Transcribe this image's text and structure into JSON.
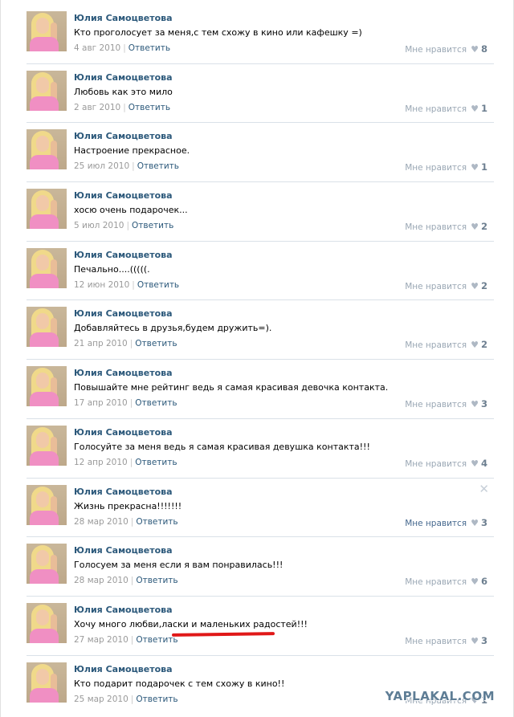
{
  "posts": [
    {
      "author": "Юлия Самоцветова",
      "text": "Кто проголосует за меня,с тем схожу в кино или кафешку =)",
      "date": "4 авг 2010",
      "reply": "Ответить",
      "like_label": "Мне нравится",
      "likes": "8"
    },
    {
      "author": "Юлия Самоцветова",
      "text": "Любовь как это мило",
      "date": "2 авг 2010",
      "reply": "Ответить",
      "like_label": "Мне нравится",
      "likes": "1"
    },
    {
      "author": "Юлия Самоцветова",
      "text": "Настроение прекрасное.",
      "date": "25 июл 2010",
      "reply": "Ответить",
      "like_label": "Мне нравится",
      "likes": "1"
    },
    {
      "author": "Юлия Самоцветова",
      "text": "хосю очень подарочек...",
      "date": "5 июл 2010",
      "reply": "Ответить",
      "like_label": "Мне нравится",
      "likes": "2"
    },
    {
      "author": "Юлия Самоцветова",
      "text": "Печально....(((((.",
      "date": "12 июн 2010",
      "reply": "Ответить",
      "like_label": "Мне нравится",
      "likes": "2"
    },
    {
      "author": "Юлия Самоцветова",
      "text": "Добавляйтесь в друзья,будем дружить=).",
      "date": "21 апр 2010",
      "reply": "Ответить",
      "like_label": "Мне нравится",
      "likes": "2"
    },
    {
      "author": "Юлия Самоцветова",
      "text": "Повышайте мне рейтинг ведь я самая красивая девочка контакта.",
      "date": "17 апр 2010",
      "reply": "Ответить",
      "like_label": "Мне нравится",
      "likes": "3"
    },
    {
      "author": "Юлия Самоцветова",
      "text": "Голосуйте за меня ведь я самая красивая девушка контакта!!!",
      "date": "12 апр 2010",
      "reply": "Ответить",
      "like_label": "Мне нравится",
      "likes": "4"
    },
    {
      "author": "Юлия Самоцветова",
      "text": "Жизнь прекрасна!!!!!!!",
      "date": "28 мар 2010",
      "reply": "Ответить",
      "like_label": "Мне нравится",
      "likes": "3"
    },
    {
      "author": "Юлия Самоцветова",
      "text": "Голосуем за меня если я вам понравилась!!!",
      "date": "28 мар 2010",
      "reply": "Ответить",
      "like_label": "Мне нравится",
      "likes": "6"
    },
    {
      "author": "Юлия Самоцветова",
      "text": "Хочу много любви,ласки и маленьких радостей!!!",
      "date": "27 мар 2010",
      "reply": "Ответить",
      "like_label": "Мне нравится",
      "likes": "3"
    },
    {
      "author": "Юлия Самоцветова",
      "text": "Кто подарит подарочек с тем схожу в кино!!",
      "date": "25 мар 2010",
      "reply": "Ответить",
      "like_label": "Мне нравится",
      "likes": "1"
    }
  ],
  "close_symbol": "✕",
  "heart_symbol": "♥",
  "separator": "|",
  "watermark": "YAPLAKAL.COM",
  "colors": {
    "author": "#2b587a",
    "link": "#2b587a",
    "meta": "#9a9a9a",
    "divider": "#dae1e8",
    "highlight": "#e01818"
  }
}
